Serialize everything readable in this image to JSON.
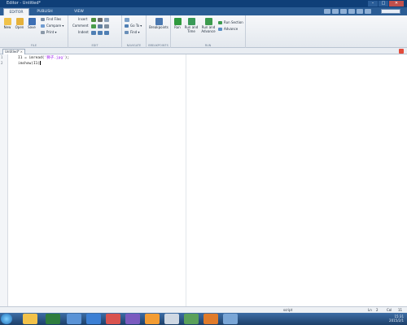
{
  "window": {
    "title": "Editor - Untitled*",
    "minimize": "–",
    "maximize": "□",
    "close": "✕"
  },
  "tabs": [
    "EDITOR",
    "PUBLISH",
    "VIEW"
  ],
  "ribbon": {
    "file": {
      "label": "FILE",
      "new": "New",
      "open": "Open",
      "save": "Save",
      "find_files": "Find Files",
      "compare": "Compare ▾",
      "print": "Print ▾"
    },
    "edit": {
      "label": "EDIT",
      "insert": "Insert",
      "comment": "Comment",
      "indent": "Indent"
    },
    "navigate": {
      "label": "NAVIGATE",
      "go_to": "Go To ▾",
      "find": "Find ▾"
    },
    "breakpoints": {
      "label": "BREAKPOINTS",
      "button": "Breakpoints"
    },
    "run": {
      "label": "RUN",
      "run": "Run",
      "run_and_time_1": "Run and",
      "run_and_time_2": "Time",
      "run_and_advance_1": "Run and",
      "run_and_advance_2": "Advance",
      "run_section": "Run Section",
      "advance": "Advance"
    }
  },
  "document": {
    "tab_label": "Untitled*",
    "close": "×",
    "line_numbers": [
      "1",
      "2"
    ],
    "line1_prefix": "I1 = imread(",
    "line1_string": "'狮子.jpg'",
    "line1_suffix": ");",
    "line2": "imshow(I1)"
  },
  "status": {
    "mode": "script",
    "ln_label": "Ln",
    "ln_value": "2",
    "col_label": "Col",
    "col_value": "11"
  },
  "taskbar": {
    "time": "15:31",
    "date": "2015/2/1"
  },
  "colors": {
    "titlebar": "#0f3f78",
    "ribbon": "#e3e8ee",
    "taskbar": "#2a5488"
  }
}
